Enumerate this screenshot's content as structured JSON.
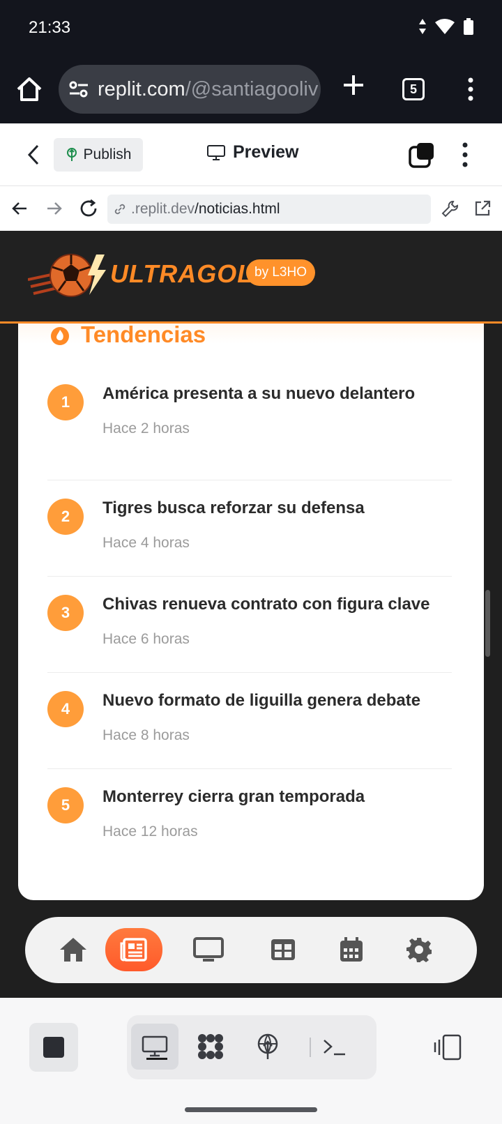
{
  "status_bar": {
    "time": "21:33"
  },
  "browser": {
    "url_host": "replit.com",
    "url_path": "/@santiagooliv",
    "tab_count": "5"
  },
  "replit_header": {
    "publish_label": "Publish",
    "preview_label": "Preview"
  },
  "dev_bar": {
    "url_prefix": ".replit.dev",
    "url_path": "/noticias.html"
  },
  "site": {
    "logo_text": "ULTRAGOL",
    "badge": "by L3HO",
    "section_title": "Tendencias",
    "trends": [
      {
        "rank": "1",
        "title": "América presenta a su nuevo delantero",
        "time": "Hace 2 horas"
      },
      {
        "rank": "2",
        "title": "Tigres busca reforzar su defensa",
        "time": "Hace 4 horas"
      },
      {
        "rank": "3",
        "title": "Chivas renueva contrato con figura clave",
        "time": "Hace 6 horas"
      },
      {
        "rank": "4",
        "title": "Nuevo formato de liguilla genera debate",
        "time": "Hace 8 horas"
      },
      {
        "rank": "5",
        "title": "Monterrey cierra gran temporada",
        "time": "Hace 12 horas"
      }
    ],
    "nav_items": [
      "home-icon",
      "newspaper-icon",
      "monitor-icon",
      "table-icon",
      "calendar-icon",
      "gear-icon"
    ],
    "active_nav": "newspaper-icon"
  },
  "colors": {
    "accent": "#ff8a26",
    "rank_badge": "#ff9d3a",
    "dark_bg": "#13151d"
  }
}
